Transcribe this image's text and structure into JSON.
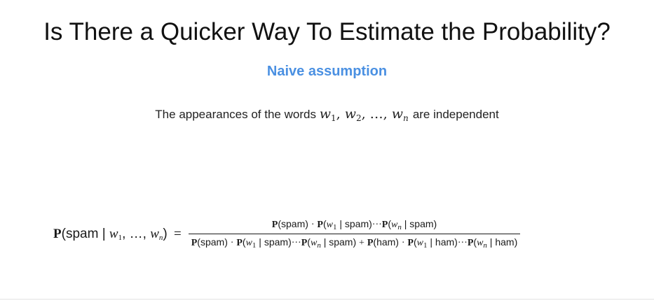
{
  "slide": {
    "title": "Is There a Quicker Way To Estimate the Probability?",
    "subtitle": "Naive assumption",
    "statement": {
      "prefix": "The appearances of the words",
      "w": "w",
      "sub1": "1",
      "sub2": "2",
      "subn": "n",
      "sep1": ", ",
      "sep2": ", …, ",
      "suffix": "are independent"
    },
    "formula": {
      "P": "P",
      "spam": "spam",
      "ham": "ham",
      "bar": "|",
      "w": "w",
      "sub1": "1",
      "subn": "n",
      "dots_args": ", …, ",
      "equals": "=",
      "dot": "·",
      "cdots": "···",
      "plus": "+"
    }
  }
}
